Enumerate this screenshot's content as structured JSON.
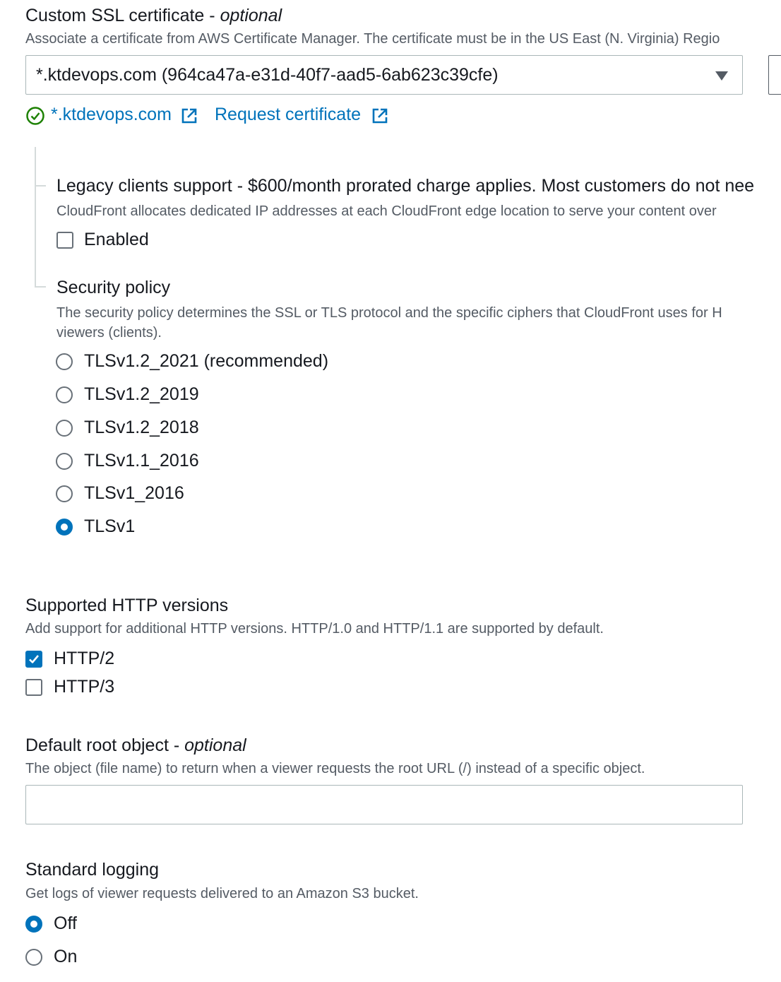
{
  "ssl": {
    "label": "Custom SSL certificate - ",
    "label_optional": "optional",
    "description": "Associate a certificate from AWS Certificate Manager. The certificate must be in the US East (N. Virginia) Regio",
    "selected_certificate": "*.ktdevops.com (964ca47a-e31d-40f7-aad5-6ab623c39cfe)",
    "cert_link": "*.ktdevops.com",
    "request_link": "Request certificate"
  },
  "legacy": {
    "label": "Legacy clients support - $600/month prorated charge applies. Most customers do not nee",
    "description": "CloudFront allocates dedicated IP addresses at each CloudFront edge location to serve your content over",
    "checkbox_label": "Enabled",
    "checked": false
  },
  "security_policy": {
    "label": "Security policy",
    "description_line1": "The security policy determines the SSL or TLS protocol and the specific ciphers that CloudFront uses for H",
    "description_line2": "viewers (clients).",
    "options": [
      "TLSv1.2_2021 (recommended)",
      "TLSv1.2_2019",
      "TLSv1.2_2018",
      "TLSv1.1_2016",
      "TLSv1_2016",
      "TLSv1"
    ],
    "selected": "TLSv1"
  },
  "http_versions": {
    "label": "Supported HTTP versions",
    "description": "Add support for additional HTTP versions. HTTP/1.0 and HTTP/1.1 are supported by default.",
    "options": [
      {
        "label": "HTTP/2",
        "checked": true
      },
      {
        "label": "HTTP/3",
        "checked": false
      }
    ]
  },
  "root_object": {
    "label": "Default root object - ",
    "label_optional": "optional",
    "description": "The object (file name) to return when a viewer requests the root URL (/) instead of a specific object.",
    "value": ""
  },
  "logging": {
    "label": "Standard logging",
    "description": "Get logs of viewer requests delivered to an Amazon S3 bucket.",
    "options": [
      "Off",
      "On"
    ],
    "selected": "Off"
  },
  "colors": {
    "accent": "#0073bb",
    "success": "#1d8102",
    "text": "#16191f",
    "muted": "#545b64"
  }
}
